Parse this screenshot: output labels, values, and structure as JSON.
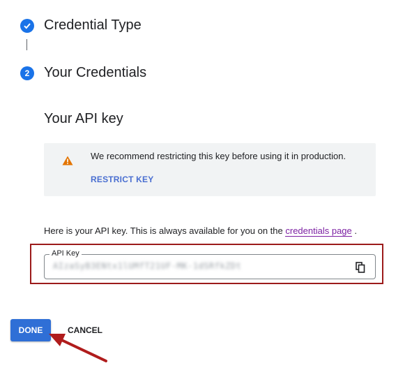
{
  "steps": [
    {
      "title": "Credential Type",
      "status": "completed",
      "icon": "check-icon"
    },
    {
      "title": "Your Credentials",
      "status": "active",
      "number": "2"
    }
  ],
  "section": {
    "title": "Your API key"
  },
  "warning": {
    "icon": "warning-icon",
    "text": "We recommend restricting this key before using it in production.",
    "link_label": "RESTRICT KEY"
  },
  "info": {
    "prefix": "Here is your API key. This is always available for you on the ",
    "link_text": "credentials page",
    "suffix": " ."
  },
  "api_key": {
    "label": "API Key",
    "value": "AIzaSyB3ENtx1lUMfT21UF-MK-1dSRfkZDt",
    "copy_icon": "copy-icon"
  },
  "actions": {
    "done_label": "DONE",
    "cancel_label": "CANCEL"
  },
  "colors": {
    "primary": "#1a73e8",
    "done_button": "#2f6fd6",
    "warning": "#e37400",
    "highlight": "#9c1b1b",
    "link_visited": "#7b1fa2"
  }
}
